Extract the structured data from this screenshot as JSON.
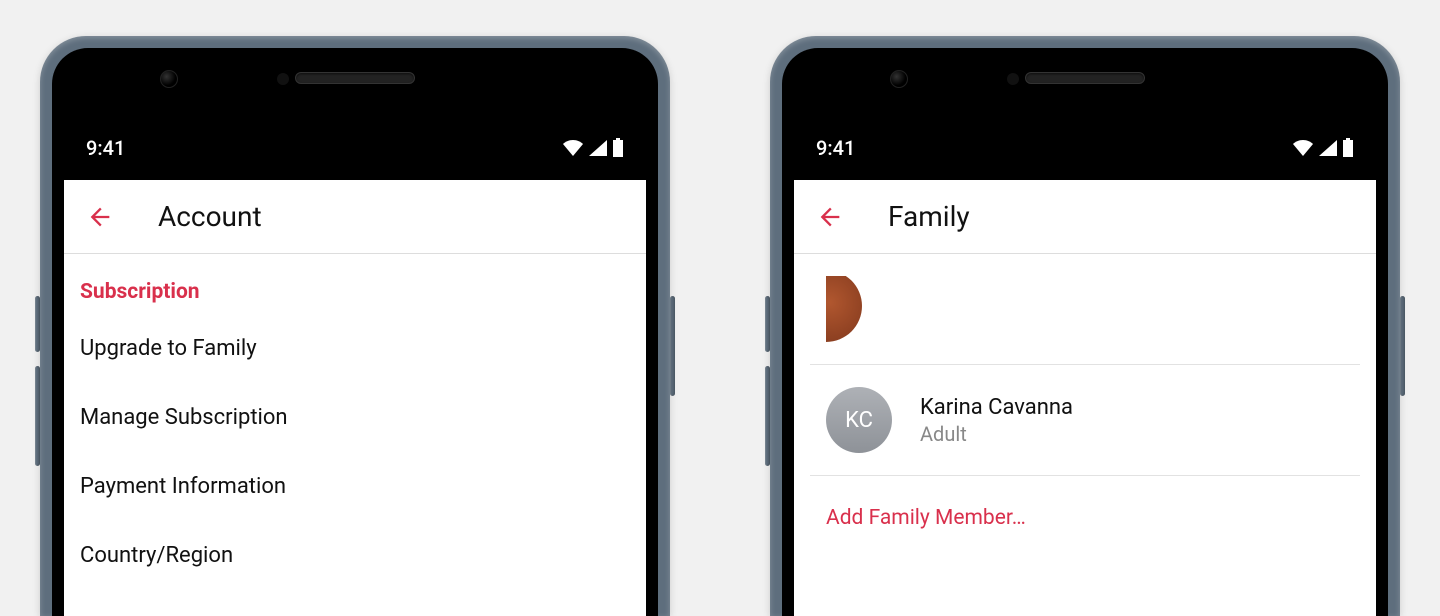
{
  "status": {
    "time": "9:41"
  },
  "colors": {
    "accent": "#d9304c"
  },
  "left": {
    "title": "Account",
    "section": "Subscription",
    "items": [
      "Upgrade to Family",
      "Manage Subscription",
      "Payment Information",
      "Country/Region"
    ]
  },
  "right": {
    "title": "Family",
    "member": {
      "initials": "KC",
      "name": "Karina Cavanna",
      "role": "Adult"
    },
    "action": "Add Family Member…"
  }
}
